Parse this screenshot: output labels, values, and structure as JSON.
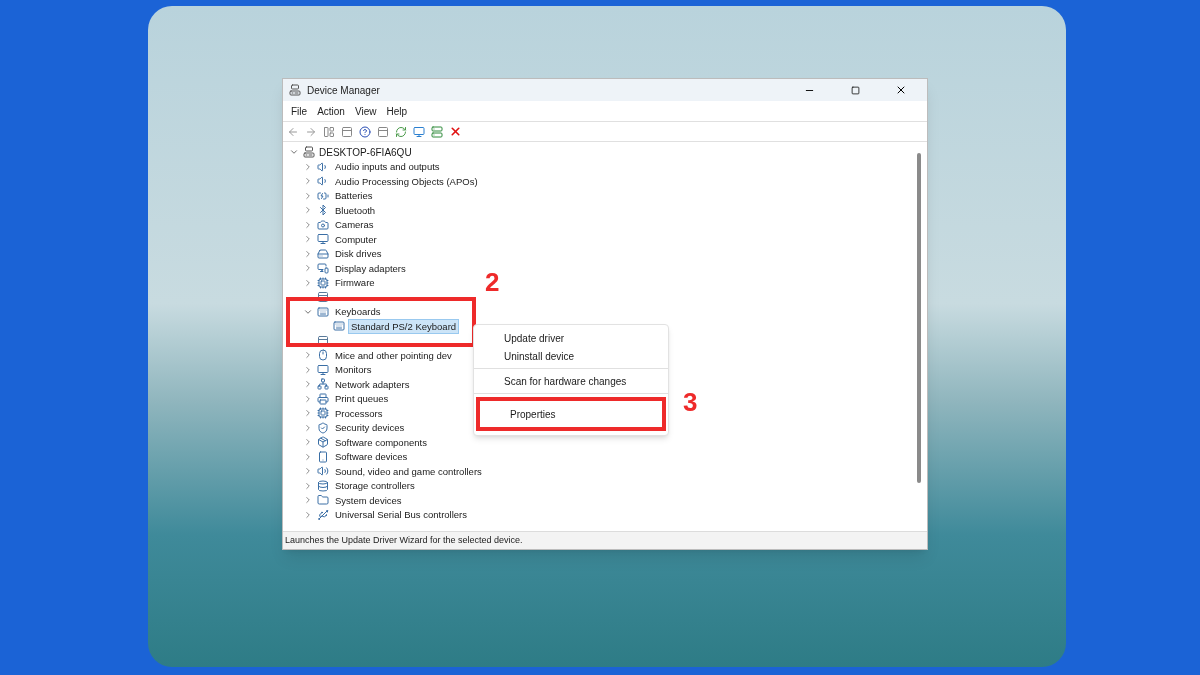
{
  "window": {
    "title": "Device Manager"
  },
  "menu": [
    "File",
    "Action",
    "View",
    "Help"
  ],
  "tree": {
    "label": "DESKTOP-6FIA6QU",
    "expanded": true,
    "children": [
      {
        "kind": "device",
        "label": "Audio inputs and outputs",
        "expanded": false,
        "selected": false
      },
      {
        "kind": "device",
        "label": "Audio Processing Objects (APOs)",
        "expanded": false,
        "selected": false
      },
      {
        "kind": "device",
        "label": "Batteries",
        "expanded": false,
        "selected": false
      },
      {
        "kind": "device",
        "label": "Bluetooth",
        "expanded": false,
        "selected": false
      },
      {
        "kind": "device",
        "label": "Cameras",
        "expanded": false,
        "selected": false
      },
      {
        "kind": "device",
        "label": "Computer",
        "expanded": false,
        "selected": false
      },
      {
        "kind": "device",
        "label": "Disk drives",
        "expanded": false,
        "selected": false
      },
      {
        "kind": "device",
        "label": "Display adapters",
        "expanded": false,
        "selected": false
      },
      {
        "kind": "device",
        "label": "Firmware",
        "expanded": false,
        "selected": false
      },
      {
        "kind": "covered"
      },
      {
        "kind": "device",
        "label": "Keyboards",
        "expanded": true,
        "selected": false,
        "children": [
          {
            "kind": "device",
            "label": "Standard PS/2 Keyboard",
            "selected": true
          }
        ]
      },
      {
        "kind": "covered"
      },
      {
        "kind": "device",
        "label": "Mice and other pointing dev",
        "expanded": false,
        "selected": false
      },
      {
        "kind": "device",
        "label": "Monitors",
        "expanded": false,
        "selected": false
      },
      {
        "kind": "device",
        "label": "Network adapters",
        "expanded": false,
        "selected": false
      },
      {
        "kind": "device",
        "label": "Print queues",
        "expanded": false,
        "selected": false
      },
      {
        "kind": "device",
        "label": "Processors",
        "expanded": false,
        "selected": false
      },
      {
        "kind": "device",
        "label": "Security devices",
        "expanded": false,
        "selected": false
      },
      {
        "kind": "device",
        "label": "Software components",
        "expanded": false,
        "selected": false
      },
      {
        "kind": "device",
        "label": "Software devices",
        "expanded": false,
        "selected": false
      },
      {
        "kind": "device",
        "label": "Sound, video and game controllers",
        "expanded": false,
        "selected": false
      },
      {
        "kind": "device",
        "label": "Storage controllers",
        "expanded": false,
        "selected": false
      },
      {
        "kind": "device",
        "label": "System devices",
        "expanded": false,
        "selected": false
      },
      {
        "kind": "device",
        "label": "Universal Serial Bus controllers",
        "expanded": false,
        "selected": false
      }
    ]
  },
  "context_menu": [
    {
      "label": "Update driver",
      "divider_after": false
    },
    {
      "label": "Uninstall device",
      "divider_after": true
    },
    {
      "label": "Scan for hardware changes",
      "divider_after": true
    },
    {
      "label": "Properties",
      "divider_after": false,
      "highlighted": true
    }
  ],
  "annotations": [
    "2",
    "3"
  ],
  "status_bar": "Launches the Update Driver Wizard for the selected device."
}
